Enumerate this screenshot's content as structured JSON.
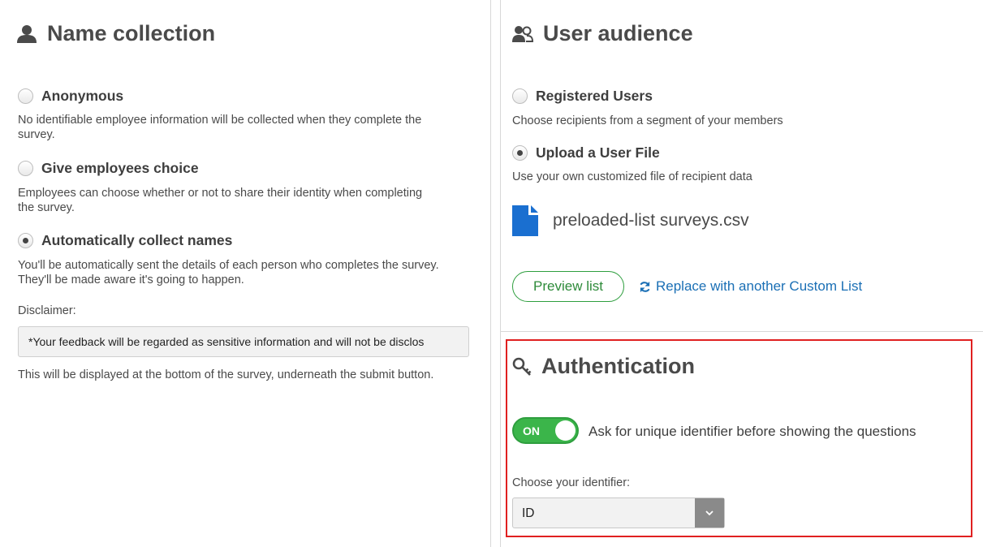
{
  "name_collection": {
    "title": "Name collection",
    "icon": "user-icon",
    "options": [
      {
        "label": "Anonymous",
        "description": "No identifiable employee information will be collected when they complete the survey.",
        "selected": false
      },
      {
        "label": "Give employees choice",
        "description": "Employees can choose whether or not to share their identity when completing the survey.",
        "selected": false
      },
      {
        "label": "Automatically collect names",
        "description": "You'll be automatically sent the details of each person who completes the survey. They'll be made aware it's going to happen.",
        "selected": true
      }
    ],
    "disclaimer_label": "Disclaimer:",
    "disclaimer_value": "*Your feedback will be regarded as sensitive information and will not be disclos",
    "disclaimer_help": "This will be displayed at the bottom of the survey, underneath the submit button."
  },
  "user_audience": {
    "title": "User audience",
    "icon": "users-icon",
    "options": [
      {
        "label": "Registered Users",
        "description": "Choose recipients from a segment of your members",
        "selected": false
      },
      {
        "label": "Upload a User File",
        "description": "Use your own customized file of recipient data",
        "selected": true
      }
    ],
    "file_name": "preloaded-list surveys.csv",
    "preview_label": "Preview list",
    "replace_label": "Replace with another Custom List"
  },
  "authentication": {
    "title": "Authentication",
    "icon": "key-icon",
    "toggle_label": "ON",
    "toggle_on": true,
    "toggle_text": "Ask for unique identifier before showing the questions",
    "identifier_label": "Choose your identifier:",
    "identifier_value": "ID"
  },
  "colors": {
    "accent_green": "#3bb54a",
    "link_blue": "#1a6fb5",
    "highlight_red": "#e02020"
  }
}
